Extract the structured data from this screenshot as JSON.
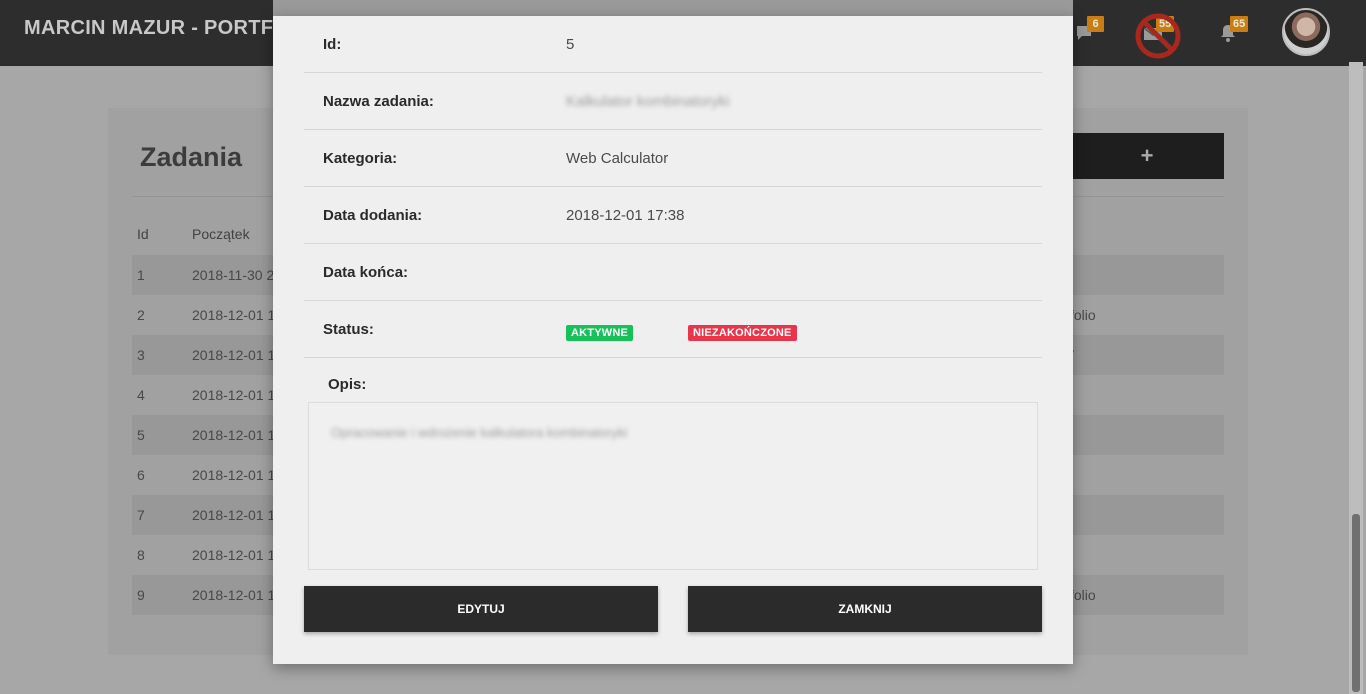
{
  "header": {
    "brand": "MARCIN MAZUR - PORTFOLIO",
    "messages_badge": "6",
    "mail_badge": "55",
    "notifications_badge": "65",
    "messages_icon": "chat-bubble-icon",
    "mail_icon": "mail-icon",
    "mail_blocked_icon": "no-entry-icon",
    "notifications_icon": "bell-icon",
    "badge_color": "#c97d12"
  },
  "page": {
    "title": "Zadania",
    "add_label": "+",
    "columns": [
      "Id",
      "Początek"
    ],
    "rows": [
      {
        "id": "1",
        "start": "2018-11-30 2",
        "right": ""
      },
      {
        "id": "2",
        "start": "2018-12-01 1",
        "right": "folio"
      },
      {
        "id": "3",
        "start": "2018-12-01 1",
        "right": "/"
      },
      {
        "id": "4",
        "start": "2018-12-01 1",
        "right": ""
      },
      {
        "id": "5",
        "start": "2018-12-01 1",
        "right": ""
      },
      {
        "id": "6",
        "start": "2018-12-01 1",
        "right": ""
      },
      {
        "id": "7",
        "start": "2018-12-01 1",
        "right": ""
      },
      {
        "id": "8",
        "start": "2018-12-01 1",
        "right": ""
      },
      {
        "id": "9",
        "start": "2018-12-01 1",
        "right": "folio"
      }
    ]
  },
  "modal": {
    "fields": {
      "id_label": "Id:",
      "id_value": "5",
      "name_label": "Nazwa zadania:",
      "name_value": "Kalkulator kombinatoryki",
      "category_label": "Kategoria:",
      "category_value": "Web Calculator",
      "added_label": "Data dodania:",
      "added_value": "2018-12-01 17:38",
      "end_label": "Data końca:",
      "end_value": "",
      "status_label": "Status:"
    },
    "status": {
      "active_label": "AKTYWNE",
      "active_color": "#18c05a",
      "unfinished_label": "NIEZAKOŃCZONE",
      "unfinished_color": "#e9354a"
    },
    "description_label": "Opis:",
    "description_text": "Opracowanie i wdrożenie kalkulatora kombinatoryki",
    "edit_label": "EDYTUJ",
    "close_label": "ZAMKNIJ"
  }
}
